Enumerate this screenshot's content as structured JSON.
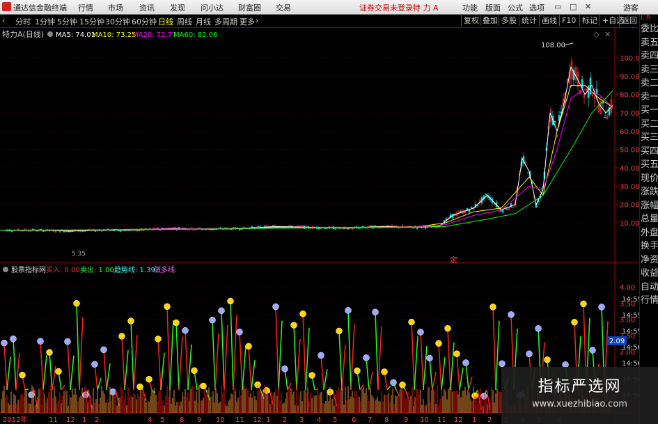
{
  "menubar": {
    "app_title": "通达信金融终端",
    "items": [
      "行情",
      "市场",
      "资讯",
      "发现",
      "问小达",
      "财富圈",
      "交易"
    ],
    "login_status": "证券交易未登录",
    "stock_name": "特 力 A",
    "right_items": [
      "功能",
      "版面",
      "公式",
      "选项"
    ],
    "visitor": "游客"
  },
  "toolbar": {
    "periods": [
      "分时",
      "1分钟",
      "5分钟",
      "15分钟",
      "30分钟",
      "60分钟",
      "日线",
      "周线",
      "月线",
      "多周期",
      "更多"
    ],
    "active": "日线",
    "right": [
      "复权",
      "叠加",
      "多股",
      "统计",
      "画线",
      "F10",
      "标记",
      "+自选",
      "返回"
    ]
  },
  "sidebar": {
    "top": [
      "L",
      "R"
    ],
    "items": [
      "委比",
      "卖五",
      "卖四",
      "卖三",
      "卖二",
      "卖一",
      "买一",
      "买二",
      "买三",
      "买四",
      "买五",
      "现价",
      "涨跌",
      "涨幅",
      "总量",
      "外盘",
      "换手",
      "净资",
      "收益",
      "自动",
      "行情"
    ]
  },
  "price_panel": {
    "title": "特力A(日线)",
    "ma": [
      {
        "label": "MA5: 74.01",
        "color": "#ffffff"
      },
      {
        "label": "MA10: 73.25",
        "color": "#ffff00"
      },
      {
        "label": "MA20: 72.77",
        "color": "#ff00ff"
      },
      {
        "label": "MA60: 82.06",
        "color": "#00ff00"
      }
    ],
    "high_label": "108.00",
    "low_label": "5.35",
    "marker": "定"
  },
  "indicator_panel": {
    "title": "股票指标网",
    "items": [
      {
        "label": "买入: 0.00",
        "color": "#ff3333"
      },
      {
        "label": "卖出: 1.00",
        "color": "#33ff33"
      },
      {
        "label": "趋势线: 1.39",
        "color": "#33ffff"
      },
      {
        "label": "做多线:",
        "color": "#ff66ff"
      }
    ],
    "current_value": "2.09"
  },
  "axis": {
    "price_ticks": [
      "100.00",
      "90.00",
      "80.00",
      "70.00",
      "60.00",
      "50.00",
      "40.00",
      "30.00",
      "20.00",
      "10.00"
    ],
    "indicator_ticks": [
      "4.00",
      "3.50",
      "3.00",
      "2.50",
      "2.00"
    ],
    "clipped_right_ticks": [
      "14:55",
      "14:55",
      "14:55",
      "14:56",
      "14:56",
      "14:56",
      "14:56"
    ],
    "dates": [
      "2012年",
      "11",
      "12",
      "1",
      "2",
      "4",
      "5",
      "8",
      "9",
      "10",
      "11",
      "12",
      "1",
      "2",
      "3",
      "4",
      "5",
      "6",
      "7",
      "8",
      "9",
      "10",
      "11",
      "12",
      "1",
      "2",
      "3",
      "4",
      "5",
      "6"
    ]
  },
  "watermark": {
    "line1": "指标严选网",
    "line2": "www.xuezhibiao.com"
  },
  "chart_data": {
    "type": "line",
    "title": "特力A(日线)",
    "ylim": [
      0,
      110
    ],
    "y_ticks": [
      10,
      20,
      30,
      40,
      50,
      60,
      70,
      80,
      90,
      100
    ],
    "series": [
      {
        "name": "MA5",
        "x": [
          0,
          50,
          100,
          150,
          200,
          250,
          300,
          350,
          400,
          450,
          500,
          550,
          600,
          630,
          650,
          680,
          700,
          720,
          740,
          750,
          760,
          770,
          780,
          790,
          800,
          810,
          820,
          830,
          840,
          850,
          860,
          870,
          880
        ],
        "values": [
          6,
          6,
          5.5,
          6,
          6,
          7,
          6.5,
          7,
          8,
          7.5,
          7,
          8,
          7.5,
          8,
          14,
          18,
          25,
          17,
          20,
          45,
          38,
          20,
          28,
          70,
          60,
          75,
          95,
          88,
          80,
          85,
          75,
          70,
          74
        ]
      },
      {
        "name": "MA10",
        "x": [
          0,
          100,
          200,
          300,
          400,
          500,
          600,
          640,
          680,
          720,
          760,
          780,
          800,
          820,
          840,
          860,
          880
        ],
        "values": [
          6,
          5.8,
          6.5,
          6.8,
          7.5,
          7.5,
          7.8,
          10,
          16,
          18,
          35,
          25,
          60,
          85,
          85,
          78,
          73
        ]
      },
      {
        "name": "MA20",
        "x": [
          0,
          100,
          200,
          300,
          400,
          500,
          600,
          640,
          680,
          720,
          760,
          780,
          800,
          820,
          840,
          860,
          880
        ],
        "values": [
          6,
          5.9,
          6.4,
          6.9,
          7.2,
          7.4,
          7.7,
          9,
          14,
          17,
          30,
          28,
          50,
          78,
          83,
          80,
          73
        ]
      },
      {
        "name": "MA60",
        "x": [
          0,
          200,
          400,
          600,
          640,
          700,
          740,
          780,
          820,
          850,
          880
        ],
        "values": [
          6,
          6.2,
          7,
          7.5,
          8,
          12,
          15,
          25,
          50,
          70,
          82
        ]
      }
    ]
  }
}
